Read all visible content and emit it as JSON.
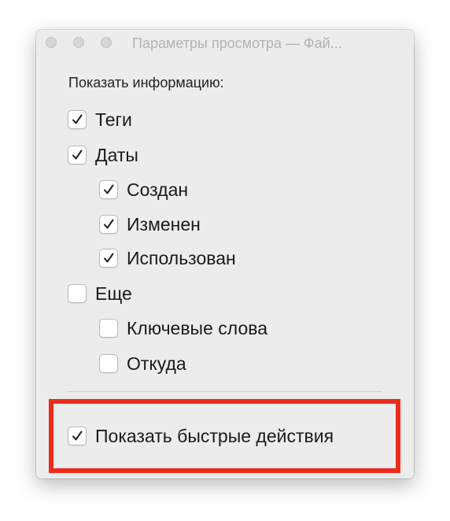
{
  "window": {
    "title": "Параметры просмотра — Фай..."
  },
  "section_label": "Показать информацию:",
  "options": {
    "tags": {
      "label": "Теги",
      "checked": true
    },
    "dates": {
      "label": "Даты",
      "checked": true
    },
    "created": {
      "label": "Создан",
      "checked": true
    },
    "modified": {
      "label": "Изменен",
      "checked": true
    },
    "used": {
      "label": "Использован",
      "checked": true
    },
    "more": {
      "label": "Еще",
      "checked": false
    },
    "keywords": {
      "label": "Ключевые слова",
      "checked": false
    },
    "where_from": {
      "label": "Откуда",
      "checked": false
    }
  },
  "quick_actions": {
    "label": "Показать быстрые действия",
    "checked": true
  },
  "colors": {
    "highlight": "#ee2a1b",
    "window_bg": "#ececec"
  },
  "icons": {
    "check": "checkmark-icon"
  }
}
